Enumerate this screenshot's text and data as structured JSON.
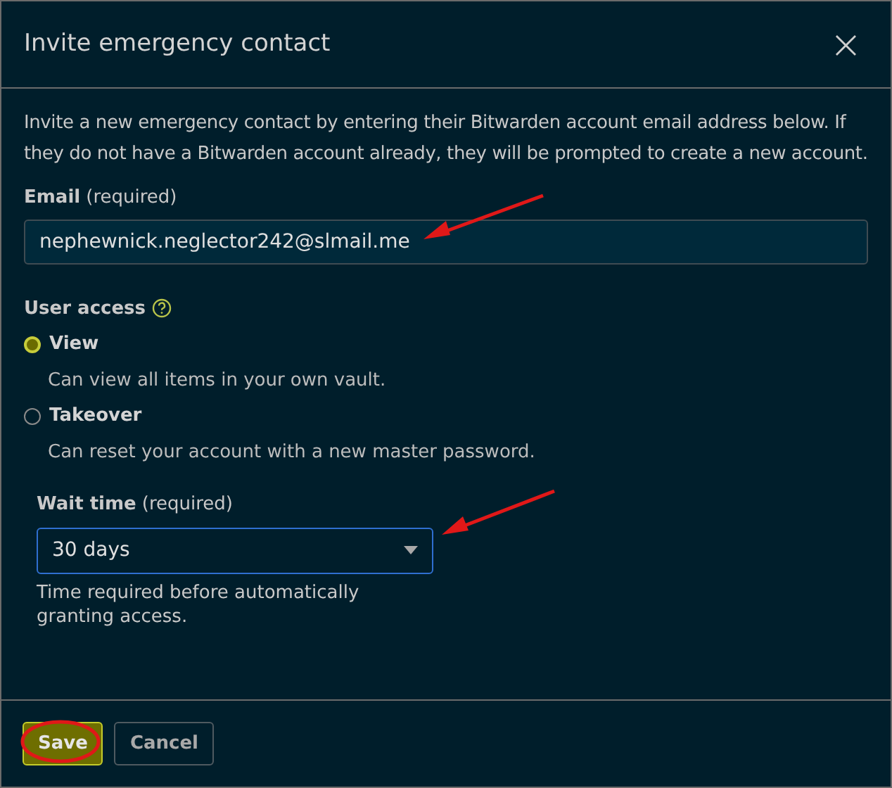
{
  "dialog": {
    "title": "Invite emergency contact",
    "close": "×"
  },
  "intro": "Invite a new emergency contact by entering their Bitwarden account email address below. If they do not have a Bitwarden account already, they will be prompted to create a new account.",
  "email": {
    "label": "Email",
    "required": "(required)",
    "value": "nephewnick.neglector242@slmail.me"
  },
  "user_access": {
    "label": "User access",
    "options": [
      {
        "label": "View",
        "description": "Can view all items in your own vault.",
        "selected": true
      },
      {
        "label": "Takeover",
        "description": "Can reset your account with a new master password.",
        "selected": false
      }
    ]
  },
  "wait_time": {
    "label": "Wait time",
    "required": "(required)",
    "value": "30 days",
    "hint": "Time required before automatically granting access."
  },
  "buttons": [
    {
      "label": "Save",
      "kind": "primary"
    },
    {
      "label": "Cancel",
      "kind": "secondary"
    }
  ]
}
